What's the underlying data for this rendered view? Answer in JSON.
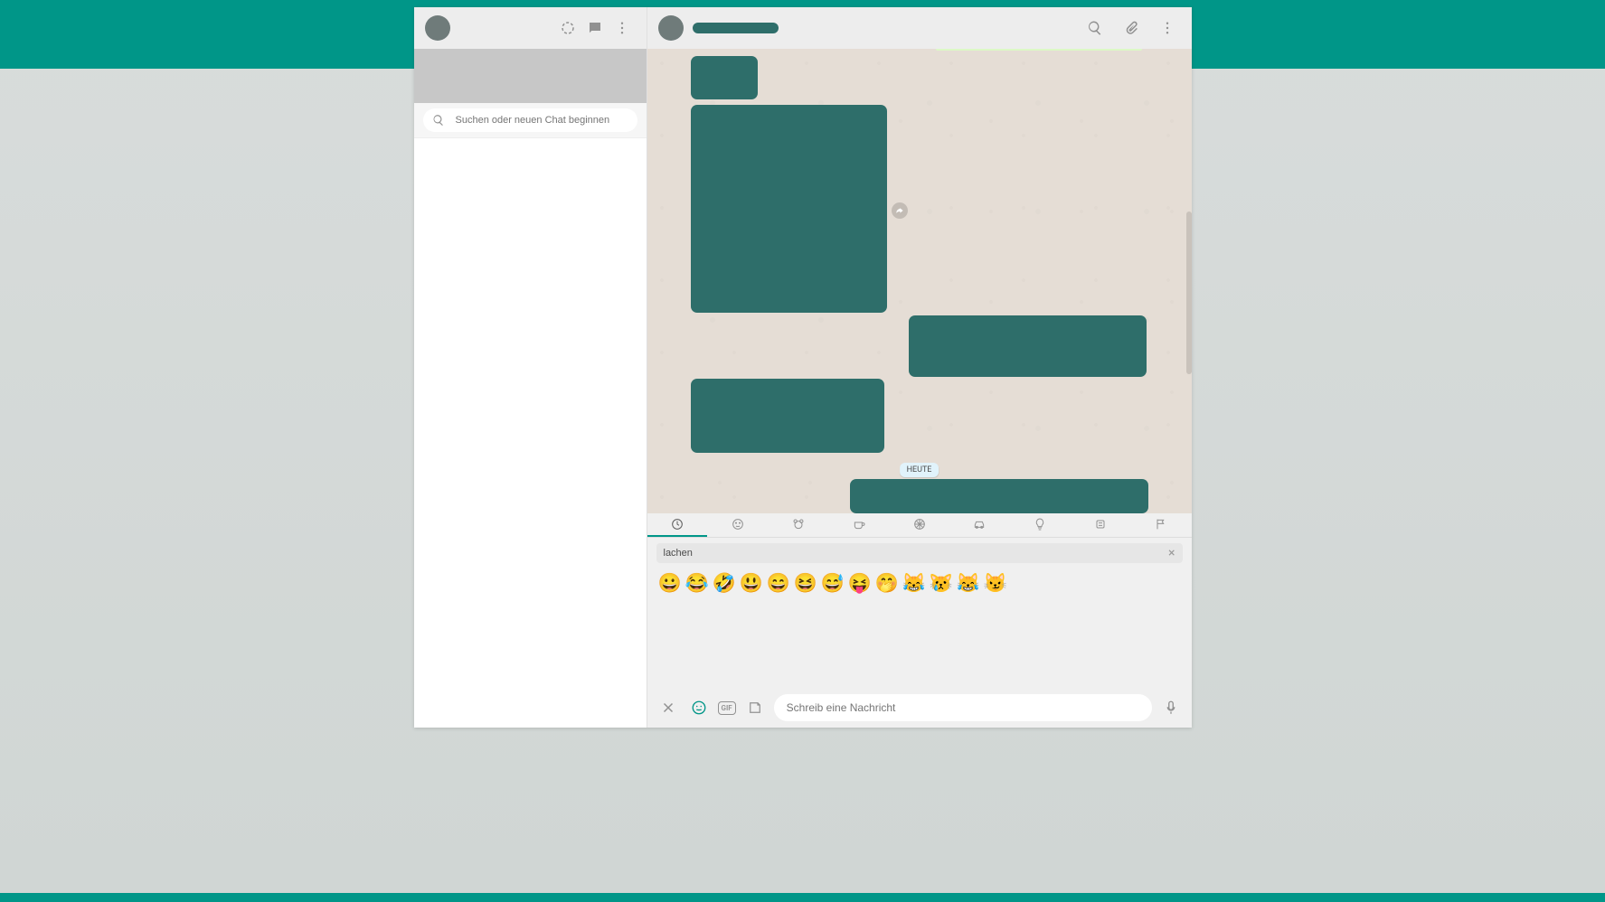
{
  "sidebar": {
    "search_placeholder": "Suchen oder neuen Chat beginnen"
  },
  "chat": {
    "contact_name": "",
    "date_chip": "HEUTE"
  },
  "emoji_picker": {
    "search_value": "lachen",
    "tabs": [
      {
        "name": "recent",
        "active": true
      },
      {
        "name": "smileys",
        "active": false
      },
      {
        "name": "animals",
        "active": false
      },
      {
        "name": "food",
        "active": false
      },
      {
        "name": "activity",
        "active": false
      },
      {
        "name": "travel",
        "active": false
      },
      {
        "name": "objects",
        "active": false
      },
      {
        "name": "symbols",
        "active": false
      },
      {
        "name": "flags",
        "active": false
      }
    ],
    "results": [
      "😀",
      "😂",
      "🤣",
      "😃",
      "😄",
      "😆",
      "😅",
      "😝",
      "🤭",
      "😹",
      "😿",
      "😹",
      "😼"
    ]
  },
  "composer": {
    "placeholder": "Schreib eine Nachricht",
    "gif_label": "GIF"
  }
}
